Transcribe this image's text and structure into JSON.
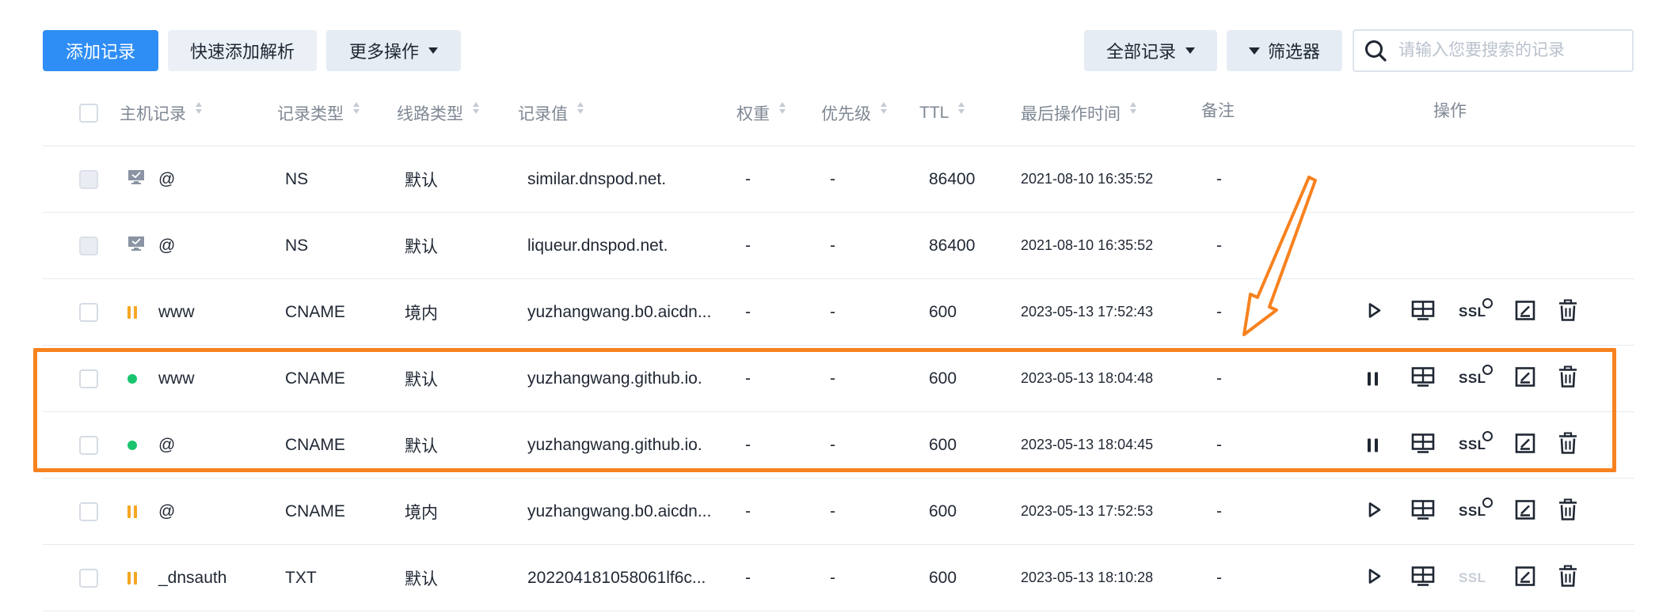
{
  "toolbar": {
    "add_record": "添加记录",
    "quick_add": "快速添加解析",
    "more_ops": "更多操作",
    "all_records": "全部记录",
    "filter": "筛选器",
    "search_placeholder": "请输入您要搜索的记录"
  },
  "columns": {
    "host": "主机记录",
    "type": "记录类型",
    "line": "线路类型",
    "value": "记录值",
    "weight": "权重",
    "priority": "优先级",
    "ttl": "TTL",
    "updated": "最后操作时间",
    "remark": "备注",
    "actions": "操作"
  },
  "rows": [
    {
      "status": "system",
      "host": "@",
      "type": "NS",
      "line": "默认",
      "value": "similar.dnspod.net.",
      "weight": "-",
      "priority": "-",
      "ttl": "86400",
      "updated": "2021-08-10 16:35:52",
      "remark": "-",
      "actions": false
    },
    {
      "status": "system",
      "host": "@",
      "type": "NS",
      "line": "默认",
      "value": "liqueur.dnspod.net.",
      "weight": "-",
      "priority": "-",
      "ttl": "86400",
      "updated": "2021-08-10 16:35:52",
      "remark": "-",
      "actions": false
    },
    {
      "status": "paused",
      "host": "www",
      "type": "CNAME",
      "line": "境内",
      "value": "yuzhangwang.b0.aicdn...",
      "weight": "-",
      "priority": "-",
      "ttl": "600",
      "updated": "2023-05-13 17:52:43",
      "remark": "-",
      "actions": true,
      "toggle": "play",
      "ssl_enabled": true
    },
    {
      "status": "active",
      "host": "www",
      "type": "CNAME",
      "line": "默认",
      "value": "yuzhangwang.github.io.",
      "weight": "-",
      "priority": "-",
      "ttl": "600",
      "updated": "2023-05-13 18:04:48",
      "remark": "-",
      "actions": true,
      "toggle": "pause",
      "ssl_enabled": true
    },
    {
      "status": "active",
      "host": "@",
      "type": "CNAME",
      "line": "默认",
      "value": "yuzhangwang.github.io.",
      "weight": "-",
      "priority": "-",
      "ttl": "600",
      "updated": "2023-05-13 18:04:45",
      "remark": "-",
      "actions": true,
      "toggle": "pause",
      "ssl_enabled": true
    },
    {
      "status": "paused",
      "host": "@",
      "type": "CNAME",
      "line": "境内",
      "value": "yuzhangwang.b0.aicdn...",
      "weight": "-",
      "priority": "-",
      "ttl": "600",
      "updated": "2023-05-13 17:52:53",
      "remark": "-",
      "actions": true,
      "toggle": "play",
      "ssl_enabled": true
    },
    {
      "status": "paused",
      "host": "_dnsauth",
      "type": "TXT",
      "line": "默认",
      "value": "202204181058061lf6c...",
      "weight": "-",
      "priority": "-",
      "ttl": "600",
      "updated": "2023-05-13 18:10:28",
      "remark": "-",
      "actions": true,
      "toggle": "play",
      "ssl_enabled": false
    }
  ],
  "ssl_label": "SSL",
  "colors": {
    "primary": "#2f8ef5",
    "highlight": "#f7821f",
    "active": "#1ac46e",
    "paused": "#f5a623"
  }
}
